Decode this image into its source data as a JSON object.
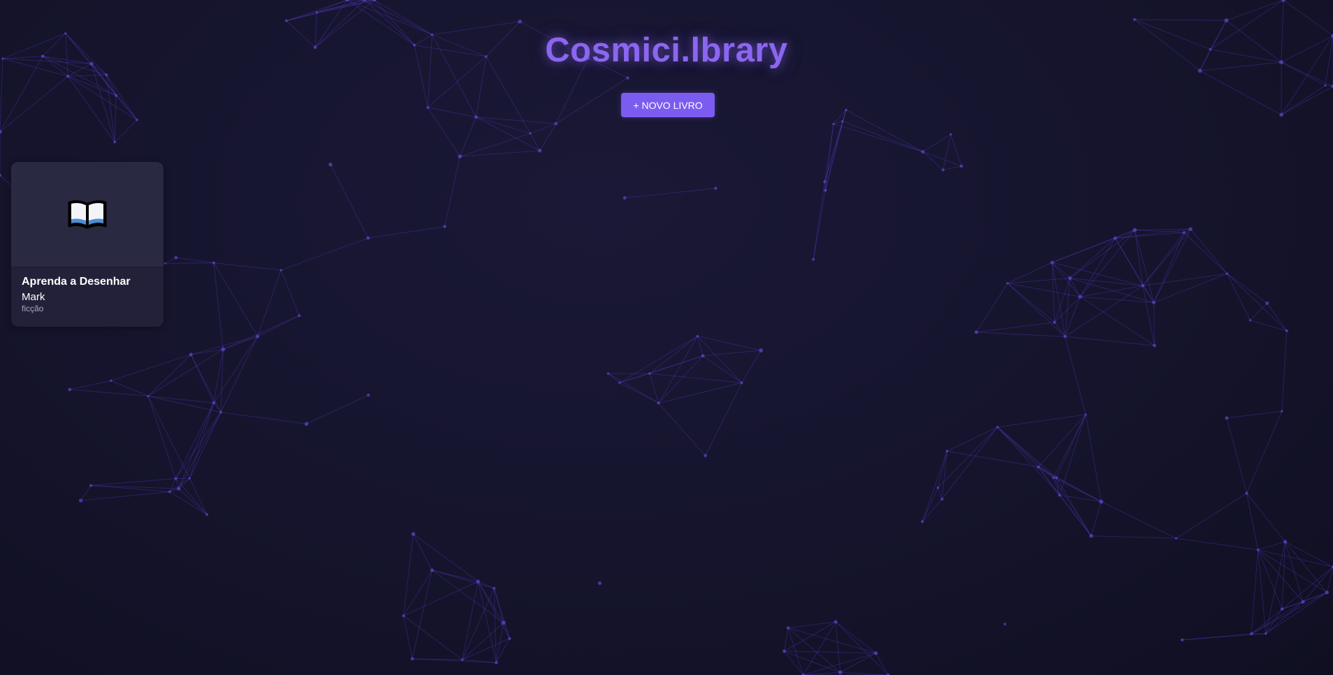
{
  "header": {
    "title": "Cosmici.lbrary",
    "new_book_label": "+ NOVO LIVRO"
  },
  "books": [
    {
      "title": "Aprenda a Desenhar",
      "author": "Mark",
      "genre": "ficção",
      "cover_icon": "open-book-icon"
    }
  ],
  "theme": {
    "accent": "#7c5cf0",
    "title_color": "#8b66f0",
    "background": "#14132a",
    "card_background": "#222139",
    "network_line_color": "#5b3fd0"
  }
}
